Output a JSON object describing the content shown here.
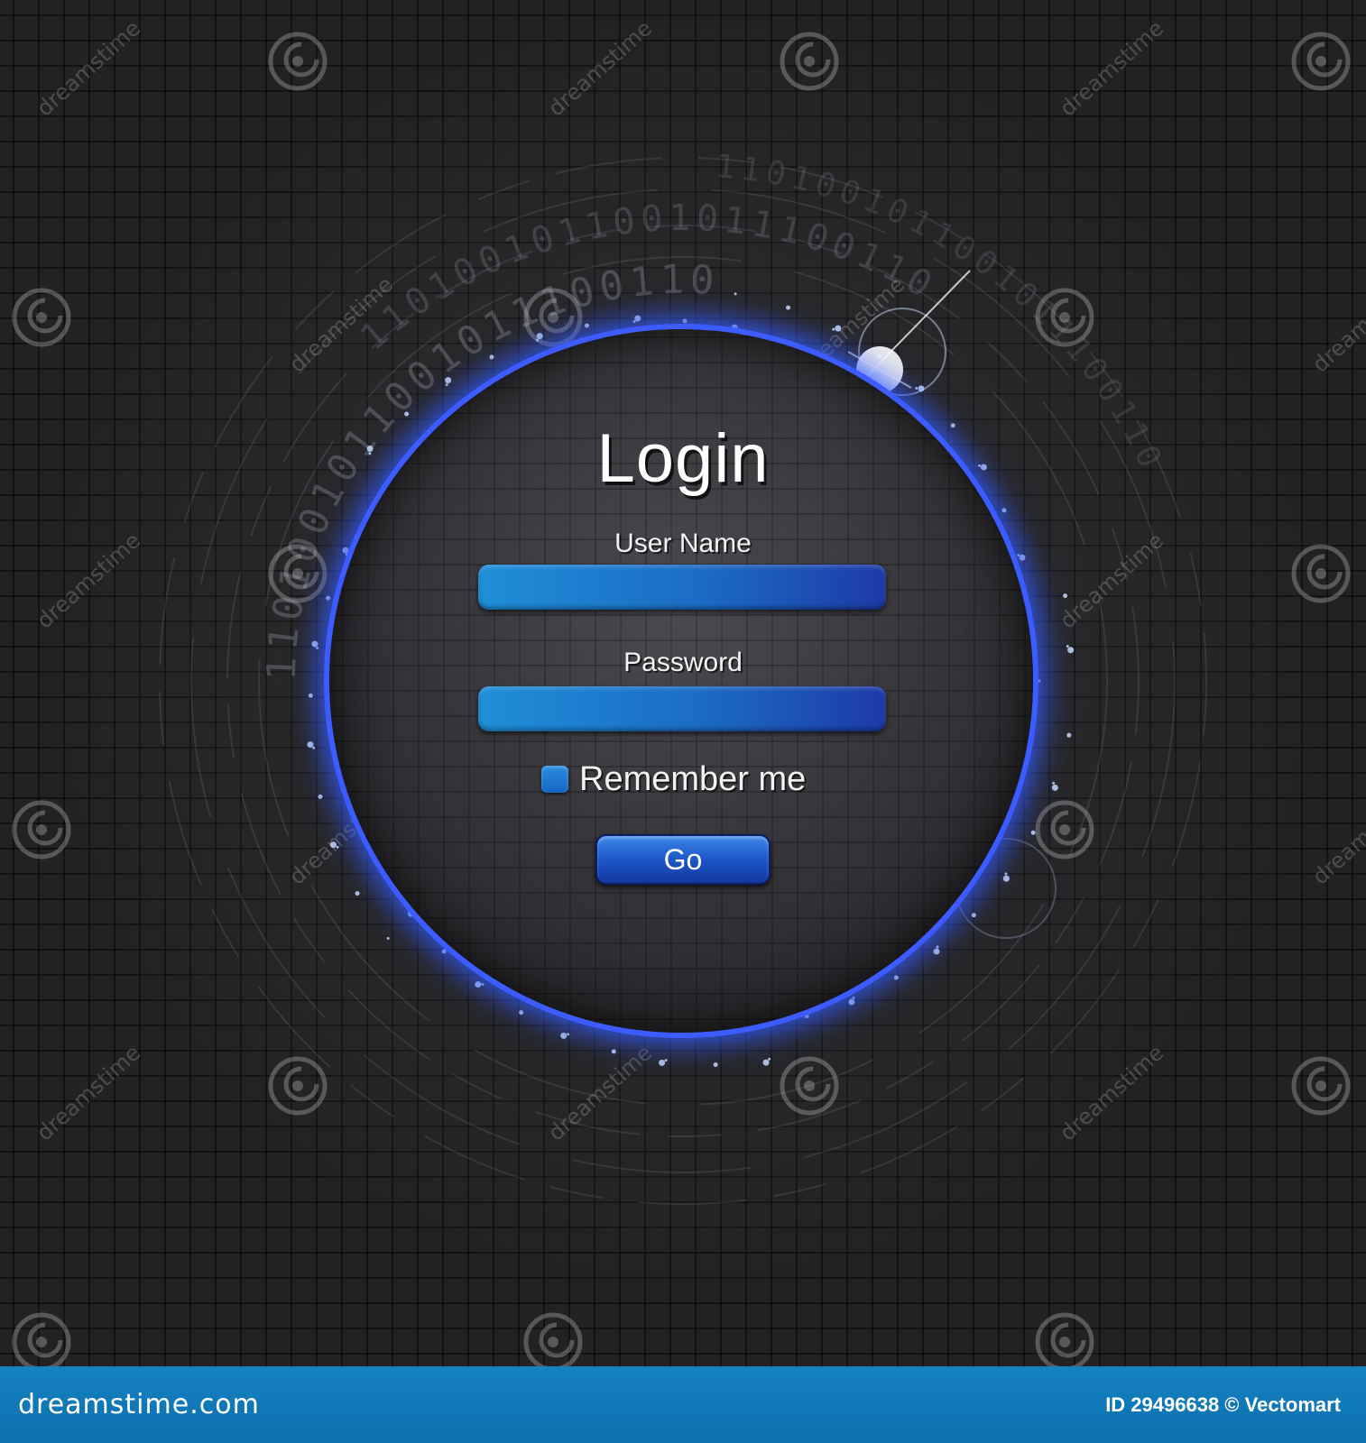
{
  "login": {
    "title": "Login",
    "username_label": "User Name",
    "username_value": "",
    "password_label": "Password",
    "password_value": "",
    "remember_label": "Remember me",
    "remember_checked": false,
    "go_label": "Go"
  },
  "watermark": {
    "text": "dreamstime",
    "binary_digits": "1101001011001011100110"
  },
  "footer": {
    "brand": "dreamstime.com",
    "credit": "ID 29496638 © Vectomart"
  },
  "colors": {
    "accent": "#3d5cff",
    "field": "#1b6bc4",
    "footer": "#1482c2"
  }
}
